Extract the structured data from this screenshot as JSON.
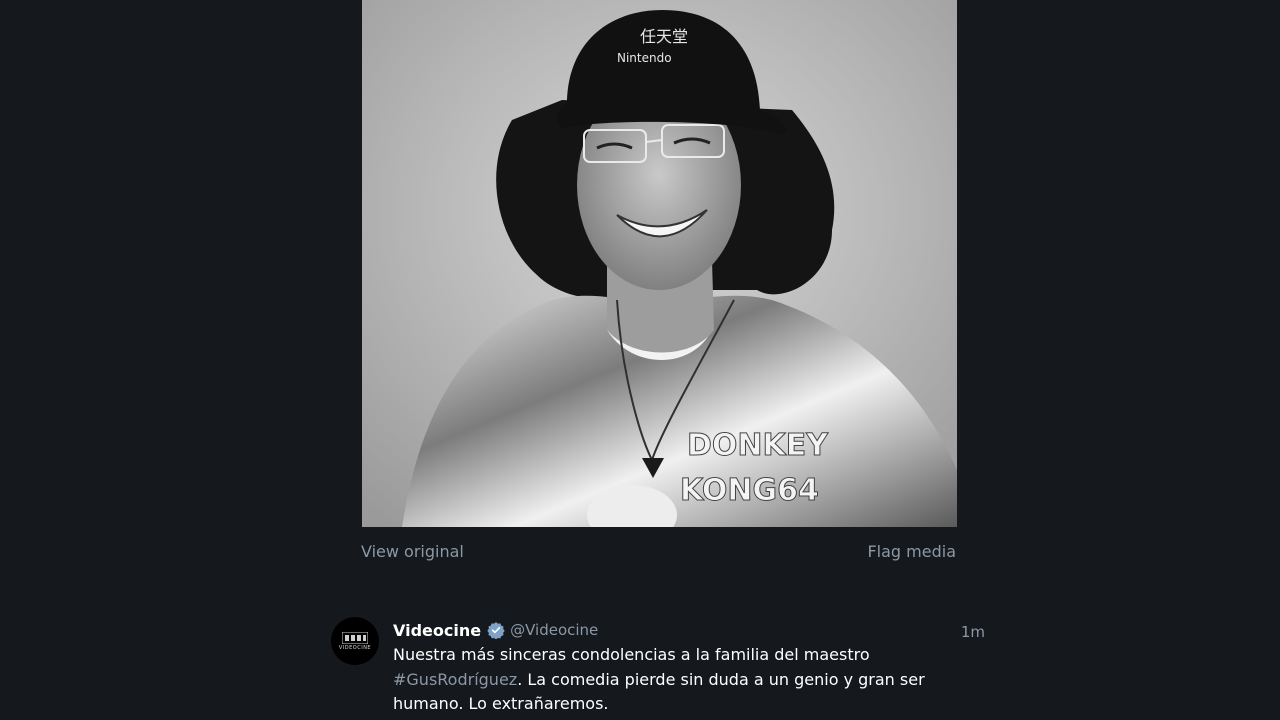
{
  "media": {
    "alt": "Black-and-white portrait photo of a smiling man wearing a Nintendo cap and a Donkey Kong shirt",
    "cap_text": "Nintendo",
    "cap_kanji": "任天堂",
    "shirt_text_line1": "DONKEY",
    "shirt_text_line2": "KONG64"
  },
  "media_actions": {
    "view_original": "View original",
    "flag_media": "Flag media"
  },
  "tweet": {
    "avatar_word": "VIDEOCINE",
    "display_name": "Videocine",
    "handle": "@Videocine",
    "timestamp": "1m",
    "verified_icon": "verified-badge-icon",
    "text_line1": "Nuestra más sinceras condolencias a la familia del maestro",
    "hashtag": "#GusRodríguez",
    "text_line2_rest": ". La comedia pierde sin duda a un genio y gran ser",
    "text_line3": "humano. Lo extrañaremos."
  },
  "colors": {
    "background": "#15181d",
    "muted_text": "#8b98a5",
    "primary_text": "#ffffff",
    "verified": "#7fa3c6"
  }
}
